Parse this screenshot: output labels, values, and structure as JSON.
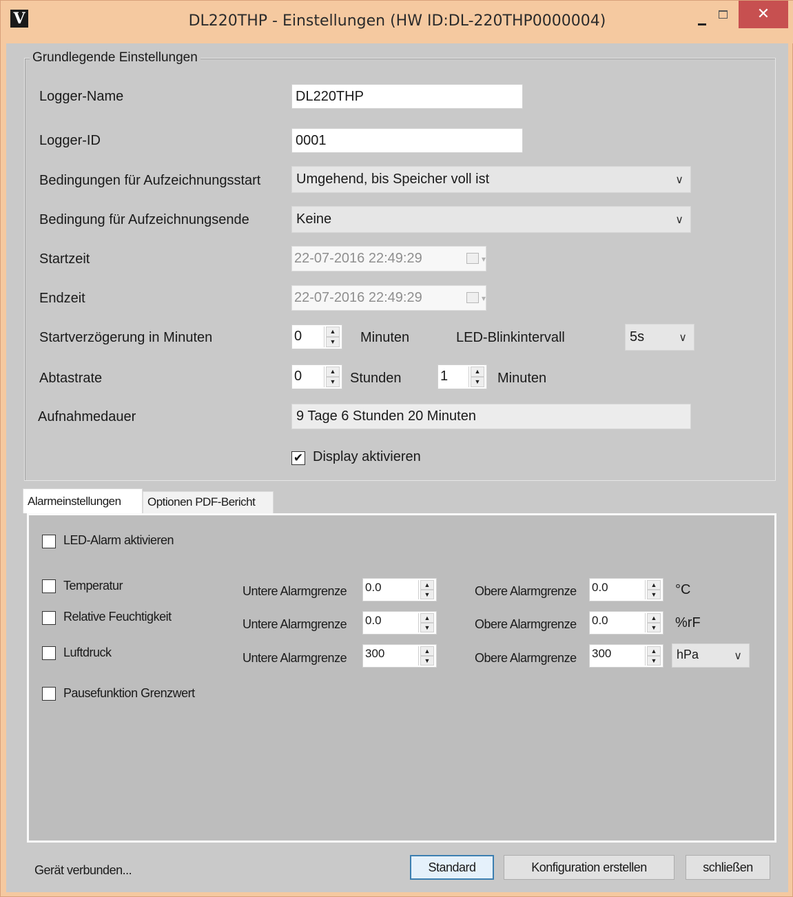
{
  "window": {
    "logo": "V",
    "title": "DL220THP - Einstellungen (HW ID:DL-220THP0000004)",
    "close_label": "✕"
  },
  "basic": {
    "legend": "Grundlegende Einstellungen",
    "logger_name_label": "Logger-Name",
    "logger_name_value": "DL220THP",
    "logger_id_label": "Logger-ID",
    "logger_id_value": "0001",
    "start_condition_label": "Bedingungen für Aufzeichnungsstart",
    "start_condition_value": "Umgehend, bis Speicher voll ist",
    "end_condition_label": "Bedingung für Aufzeichnungsende",
    "end_condition_value": "Keine",
    "start_time_label": "Startzeit",
    "start_time_value": "22-07-2016 22:49:29",
    "end_time_label": "Endzeit",
    "end_time_value": "22-07-2016 22:49:29",
    "start_delay_label": "Startverzögerung in Minuten",
    "start_delay_value": "0",
    "start_delay_unit": "Minuten",
    "led_blink_label": "LED-Blinkintervall",
    "led_blink_value": "5s",
    "sample_rate_label": "Abtastrate",
    "sample_hours_value": "0",
    "sample_hours_unit": "Stunden",
    "sample_minutes_value": "1",
    "sample_minutes_unit": "Minuten",
    "duration_label": "Aufnahmedauer",
    "duration_value": "9 Tage 6 Stunden 20 Minuten",
    "display_enable_label": "Display aktivieren",
    "display_enable_checked": true
  },
  "tabs": [
    {
      "label": "Alarmeinstellungen",
      "active": true
    },
    {
      "label": "Optionen PDF-Bericht",
      "active": false
    }
  ],
  "alarm": {
    "led_alarm_label": "LED-Alarm aktivieren",
    "lower_label": "Untere Alarmgrenze",
    "upper_label": "Obere Alarmgrenze",
    "rows": [
      {
        "label": "Temperatur",
        "lower": "0.0",
        "upper": "0.0",
        "unit": "°C"
      },
      {
        "label": "Relative Feuchtigkeit",
        "lower": "0.0",
        "upper": "0.0",
        "unit": "%rF"
      },
      {
        "label": "Luftdruck",
        "lower": "300",
        "upper": "300",
        "unit": "hPa"
      }
    ],
    "pause_label": "Pausefunktion Grenzwert"
  },
  "footer": {
    "status": "Gerät verbunden...",
    "standard_button": "Standard",
    "create_config_button": "Konfiguration erstellen",
    "close_button": "schließen"
  }
}
